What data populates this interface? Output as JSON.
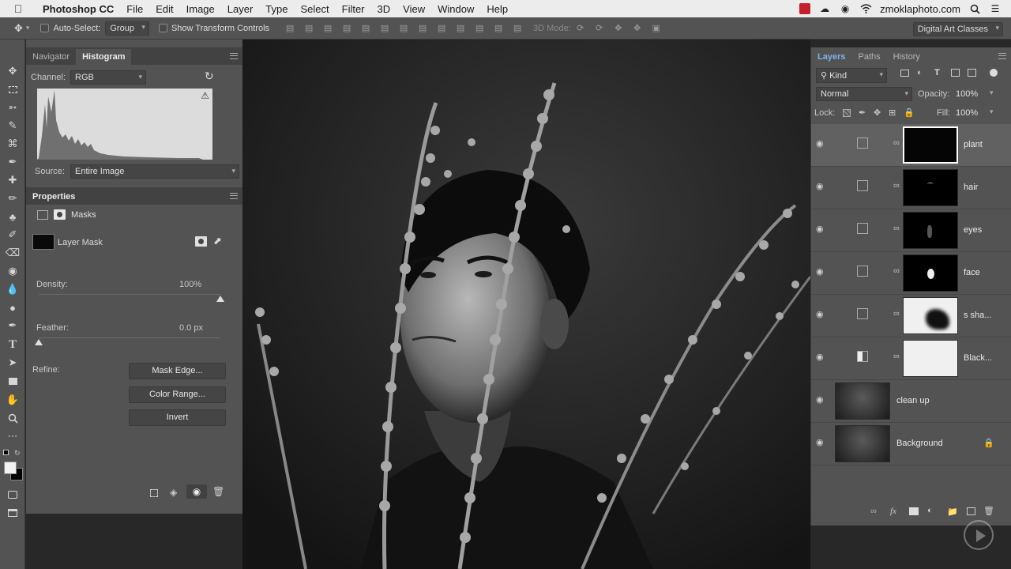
{
  "menubar": {
    "app_name": "Photoshop CC",
    "items": [
      "File",
      "Edit",
      "Image",
      "Layer",
      "Type",
      "Select",
      "Filter",
      "3D",
      "View",
      "Window",
      "Help"
    ],
    "account": "zmoklaphoto.com"
  },
  "options_bar": {
    "auto_select_label": "Auto-Select:",
    "auto_select_value": "Group",
    "show_transform_label": "Show Transform Controls",
    "mode_3d_label": "3D Mode:",
    "workspace": "Digital Art Classes"
  },
  "navigator_panel": {
    "tabs": [
      "Navigator",
      "Histogram"
    ],
    "active_tab": "Histogram",
    "channel_label": "Channel:",
    "channel_value": "RGB",
    "source_label": "Source:",
    "source_value": "Entire Image"
  },
  "properties_panel": {
    "title": "Properties",
    "section": "Masks",
    "mask_type": "Layer Mask",
    "density_label": "Density:",
    "density_value": "100%",
    "density_fraction": 1.0,
    "feather_label": "Feather:",
    "feather_value": "0.0 px",
    "feather_fraction": 0.0,
    "refine_label": "Refine:",
    "buttons": {
      "mask_edge": "Mask Edge...",
      "color_range": "Color Range...",
      "invert": "Invert"
    }
  },
  "layers_panel": {
    "tabs": [
      "Layers",
      "Paths",
      "History"
    ],
    "active_tab": "Layers",
    "filter_kind": "Kind",
    "blend_mode": "Normal",
    "opacity_label": "Opacity:",
    "opacity_value": "100%",
    "lock_label": "Lock:",
    "fill_label": "Fill:",
    "fill_value": "100%",
    "layers": [
      {
        "name": "plant",
        "kind": "curves",
        "selected": true
      },
      {
        "name": "hair",
        "kind": "curves",
        "selected": false
      },
      {
        "name": "eyes",
        "kind": "curves",
        "selected": false
      },
      {
        "name": "face",
        "kind": "curves",
        "selected": false
      },
      {
        "name": "s sha...",
        "kind": "curves",
        "selected": false
      },
      {
        "name": "Black...",
        "kind": "black-white",
        "selected": false
      },
      {
        "name": "clean up",
        "kind": "pixel",
        "selected": false
      },
      {
        "name": "Background",
        "kind": "pixel",
        "selected": false,
        "locked": true
      }
    ]
  }
}
